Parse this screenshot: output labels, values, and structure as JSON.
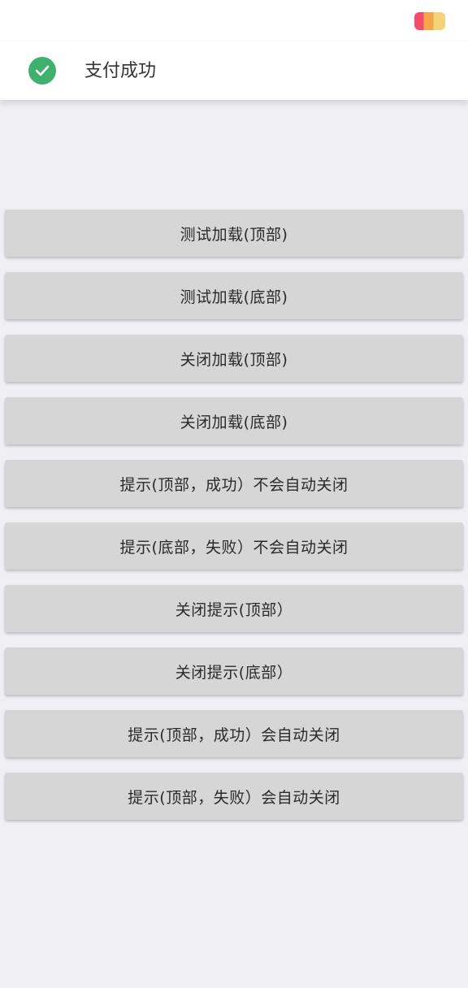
{
  "status_bar": {
    "battery_icon": "battery-icon"
  },
  "toast": {
    "icon": "check-circle-icon",
    "icon_color": "#3fb06e",
    "message": "支付成功"
  },
  "buttons": [
    {
      "label": "测试加载(顶部)"
    },
    {
      "label": "测试加载(底部)"
    },
    {
      "label": "关闭加载(顶部)"
    },
    {
      "label": "关闭加载(底部)"
    },
    {
      "label": "提示(顶部，成功）不会自动关闭"
    },
    {
      "label": "提示(底部，失败）不会自动关闭"
    },
    {
      "label": "关闭提示(顶部）"
    },
    {
      "label": "关闭提示(底部）"
    },
    {
      "label": "提示(顶部，成功）会自动关闭"
    },
    {
      "label": "提示(顶部，失败）会自动关闭"
    }
  ]
}
